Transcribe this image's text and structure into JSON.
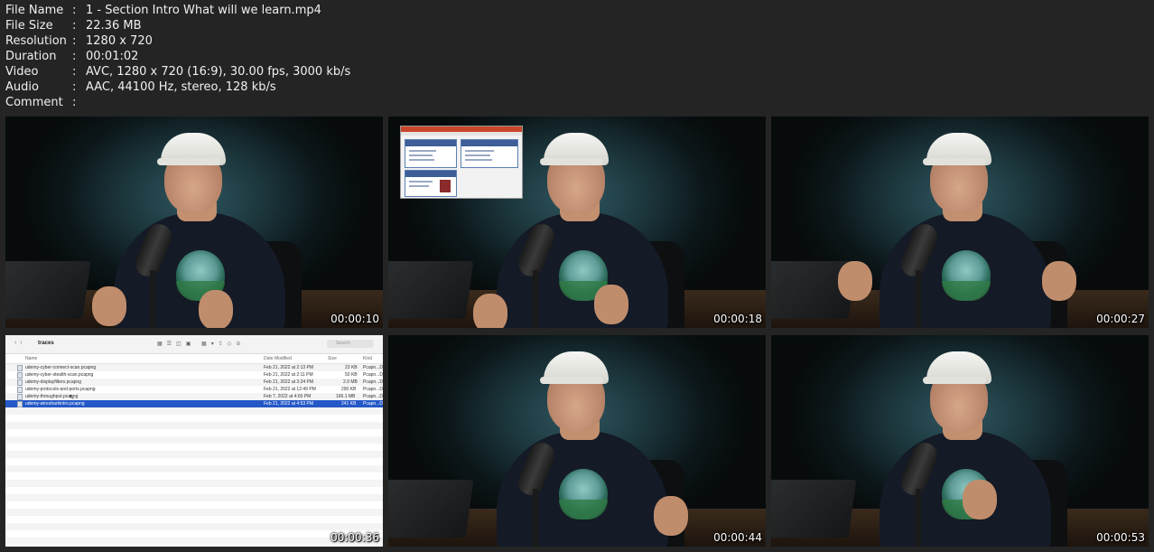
{
  "info": [
    {
      "key": "File Name",
      "value": "1 - Section Intro What will we learn.mp4"
    },
    {
      "key": "File Size",
      "value": "22.36 MB"
    },
    {
      "key": "Resolution",
      "value": "1280 x 720"
    },
    {
      "key": "Duration",
      "value": "00:01:02"
    },
    {
      "key": "Video",
      "value": "AVC, 1280 x 720 (16:9), 30.00 fps, 3000 kb/s"
    },
    {
      "key": "Audio",
      "value": "AAC, 44100 Hz, stereo, 128 kb/s"
    },
    {
      "key": "Comment",
      "value": ""
    }
  ],
  "separator": ":",
  "thumbnails": [
    {
      "timestamp": "00:00:10",
      "kind": "presenter"
    },
    {
      "timestamp": "00:00:18",
      "kind": "presenter-with-slides"
    },
    {
      "timestamp": "00:00:27",
      "kind": "presenter"
    },
    {
      "timestamp": "00:00:36",
      "kind": "finder"
    },
    {
      "timestamp": "00:00:44",
      "kind": "presenter"
    },
    {
      "timestamp": "00:00:53",
      "kind": "presenter"
    }
  ],
  "finder": {
    "folder": "traces",
    "search_placeholder": "Search",
    "columns": {
      "name": "Name",
      "date": "Date Modified",
      "size": "Size",
      "kind": "Kind"
    },
    "files": [
      {
        "name": "udemy-cyber-connect-scan.pcapng",
        "date": "Feb 21, 2022 at 2:13 PM",
        "size": "23 KB",
        "kind": "Pcapn...D"
      },
      {
        "name": "udemy-cyber-stealth-scan.pcapng",
        "date": "Feb 21, 2022 at 2:11 PM",
        "size": "50 KB",
        "kind": "Pcapn...D"
      },
      {
        "name": "udemy-displayfilters.pcapng",
        "date": "Feb 21, 2022 at 3:24 PM",
        "size": "2.9 MB",
        "kind": "Pcapn...D"
      },
      {
        "name": "udemy-protocols-and-ports.pcapng",
        "date": "Feb 21, 2022 at 12:49 PM",
        "size": "290 KB",
        "kind": "Pcapn...D"
      },
      {
        "name": "udemy-throughput.pcapng",
        "date": "Feb 7, 2022 at 4:00 PM",
        "size": "166.1 MB",
        "kind": "Pcapn...D"
      },
      {
        "name": "udemy-wiresharkintro.pcapng",
        "date": "Feb 21, 2022 at 4:53 PM",
        "size": "241 KB",
        "kind": "Pcapn...D",
        "selected": true
      }
    ]
  },
  "colors": {
    "background": "#242424",
    "selection": "#2458c7"
  }
}
